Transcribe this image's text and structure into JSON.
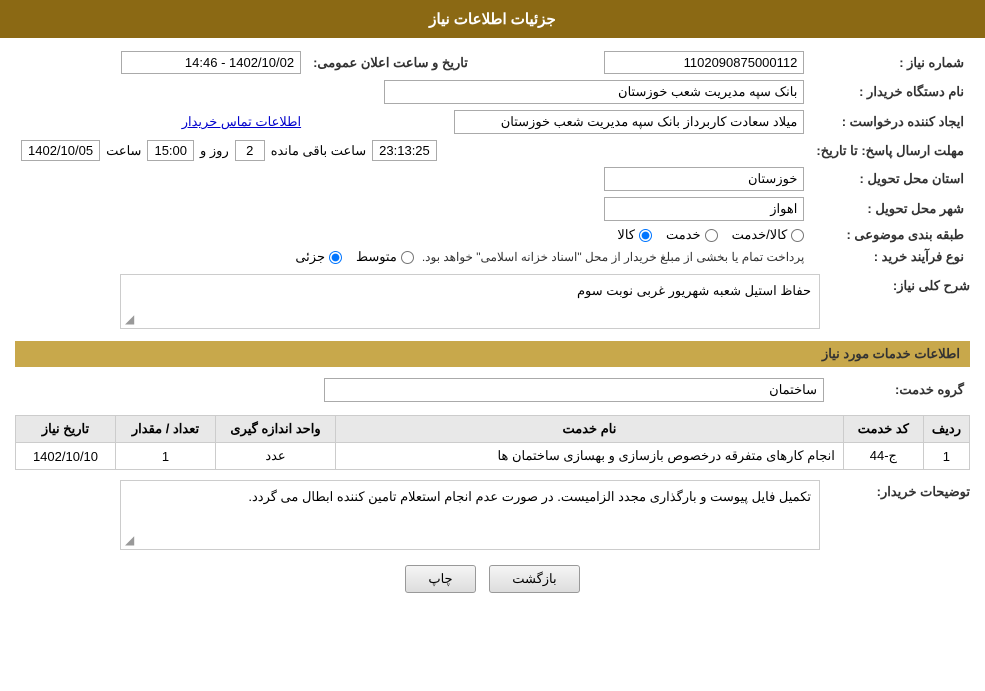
{
  "header": {
    "title": "جزئیات اطلاعات نیاز"
  },
  "fields": {
    "shomara_niaz_label": "شماره نیاز :",
    "shomara_niaz_value": "1102090875000112",
    "name_dastgah_label": "نام دستگاه خریدار :",
    "name_dastgah_value": "بانک سپه مدیریت شعب خوزستان",
    "ijad_label": "ایجاد کننده درخواست :",
    "ijad_value": "میلاد سعادت کاربرداز بانک سپه مدیریت شعب خوزستان",
    "etelaeat_link": "اطلاعات تماس خریدار",
    "mohlat_label": "مهلت ارسال پاسخ: تا تاریخ:",
    "date_value": "1402/10/05",
    "saat_label": "ساعت",
    "saat_value": "15:00",
    "roz_label": "روز و",
    "roz_value": "2",
    "baqi_label": "ساعت باقی مانده",
    "baqi_value": "23:13:25",
    "ostan_label": "استان محل تحویل :",
    "ostan_value": "خوزستان",
    "shahr_label": "شهر محل تحویل :",
    "shahr_value": "اهواز",
    "tabagheh_label": "طبقه بندی موضوعی :",
    "kala_label": "کالا",
    "khedmat_label": "خدمت",
    "kala_khedmat_label": "کالا/خدمت",
    "type_kharid_label": "نوع فرآیند خرید :",
    "jozi_label": "جزئی",
    "motavaset_label": "متوسط",
    "pardakht_text": "پرداخت تمام یا بخشی از مبلغ خریدار از محل \"اسناد خزانه اسلامی\" خواهد بود.",
    "sharh_label": "شرح کلی نیاز:",
    "sharh_value": "حفاظ استیل شعبه شهریور غربی نوبت سوم",
    "khadamat_label": "اطلاعات خدمات مورد نیاز",
    "group_label": "گروه خدمت:",
    "group_value": "ساختمان",
    "announce_label": "تاریخ و ساعت اعلان عمومی:",
    "announce_value": "1402/10/02 - 14:46"
  },
  "services_table": {
    "headers": [
      "ردیف",
      "کد خدمت",
      "نام خدمت",
      "واحد اندازه گیری",
      "تعداد / مقدار",
      "تاریخ نیاز"
    ],
    "rows": [
      {
        "radif": "1",
        "code": "ج-44",
        "name": "انجام کارهای متفرقه درخصوص بازسازی و بهسازی ساختمان ها",
        "vahed": "عدد",
        "tedad": "1",
        "tarikh": "1402/10/10"
      }
    ]
  },
  "buyer_description": {
    "label": "توضیحات خریدار:",
    "value": "تکمیل فایل پیوست و بارگذاری مجدد الزامیست. در صورت عدم انجام استعلام تامین کننده ابطال می گردد."
  },
  "buttons": {
    "print": "چاپ",
    "back": "بازگشت"
  }
}
